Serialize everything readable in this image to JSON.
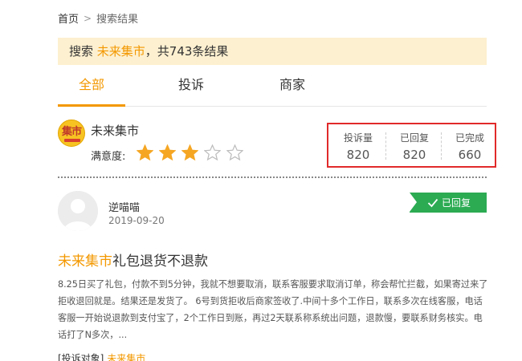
{
  "breadcrumb": {
    "home": "首页",
    "separator": ">",
    "current": "搜索结果"
  },
  "search_banner": {
    "prefix": "搜索 ",
    "keyword": "未来集市",
    "suffix": "，共743条结果"
  },
  "tabs": [
    {
      "label": "全部",
      "active": true
    },
    {
      "label": "投诉",
      "active": false
    },
    {
      "label": "商家",
      "active": false
    }
  ],
  "merchant": {
    "logo_text": "集市",
    "name": "未来集市",
    "rating_label": "满意度:",
    "rating": 3,
    "rating_max": 5,
    "stats": [
      {
        "label": "投诉量",
        "value": "820"
      },
      {
        "label": "已回复",
        "value": "820"
      },
      {
        "label": "已完成",
        "value": "660"
      }
    ]
  },
  "complaint": {
    "user_name": "逆喵喵",
    "date": "2019-09-20",
    "status": "已回复",
    "title_keyword": "未来集市",
    "title_rest": "礼包退货不退款",
    "body": "8.25日买了礼包，付款不到5分钟，我就不想要取消，联系客服要求取消订单，称会帮忙拦截，如果寄过来了拒收退回就是。结果还是发货了。 6号到货拒收后商家签收了.中间十多个工作日，联系多次在线客服，电话客服一开始说退款到支付宝了，2个工作日到账，再过2天联系称系统出问题，退款慢，要联系财务核实。电话打了N多次，...",
    "target_label": "[投诉对象]",
    "target_name": "未来集市"
  },
  "colors": {
    "accent": "#f39800",
    "banner_bg": "#fdf0d0",
    "status_green": "#2cab53",
    "highlight_border": "#e12a2a",
    "star": "#f5a623"
  }
}
